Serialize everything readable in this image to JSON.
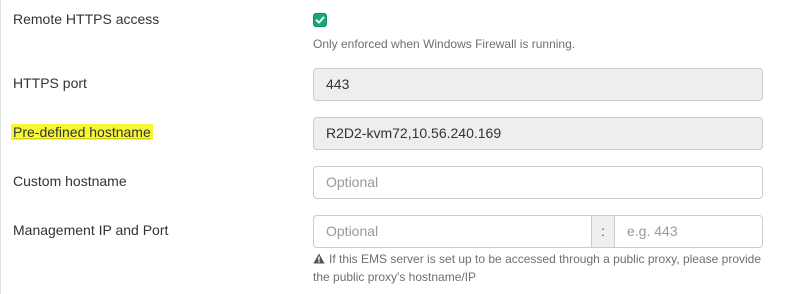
{
  "remote_https": {
    "label": "Remote HTTPS access",
    "checked": true,
    "help": "Only enforced when Windows Firewall is running."
  },
  "https_port": {
    "label": "HTTPS port",
    "value": "443"
  },
  "predefined_hostname": {
    "label": "Pre-defined hostname",
    "value": "R2D2-kvm72,10.56.240.169",
    "highlight_color": "#f7f732"
  },
  "custom_hostname": {
    "label": "Custom hostname",
    "placeholder": "Optional"
  },
  "management": {
    "label": "Management IP and Port",
    "ip_placeholder": "Optional",
    "separator": ":",
    "port_placeholder": "e.g. 443",
    "help_line1": "If this EMS server is set up to be accessed through a public proxy, please provide",
    "help_line2": "the public proxy's hostname/IP",
    "warning_icon": "warning-icon"
  },
  "colors": {
    "checkbox": "#1aa67a",
    "readonly_bg": "#eeeeee",
    "border": "#cccccc"
  }
}
